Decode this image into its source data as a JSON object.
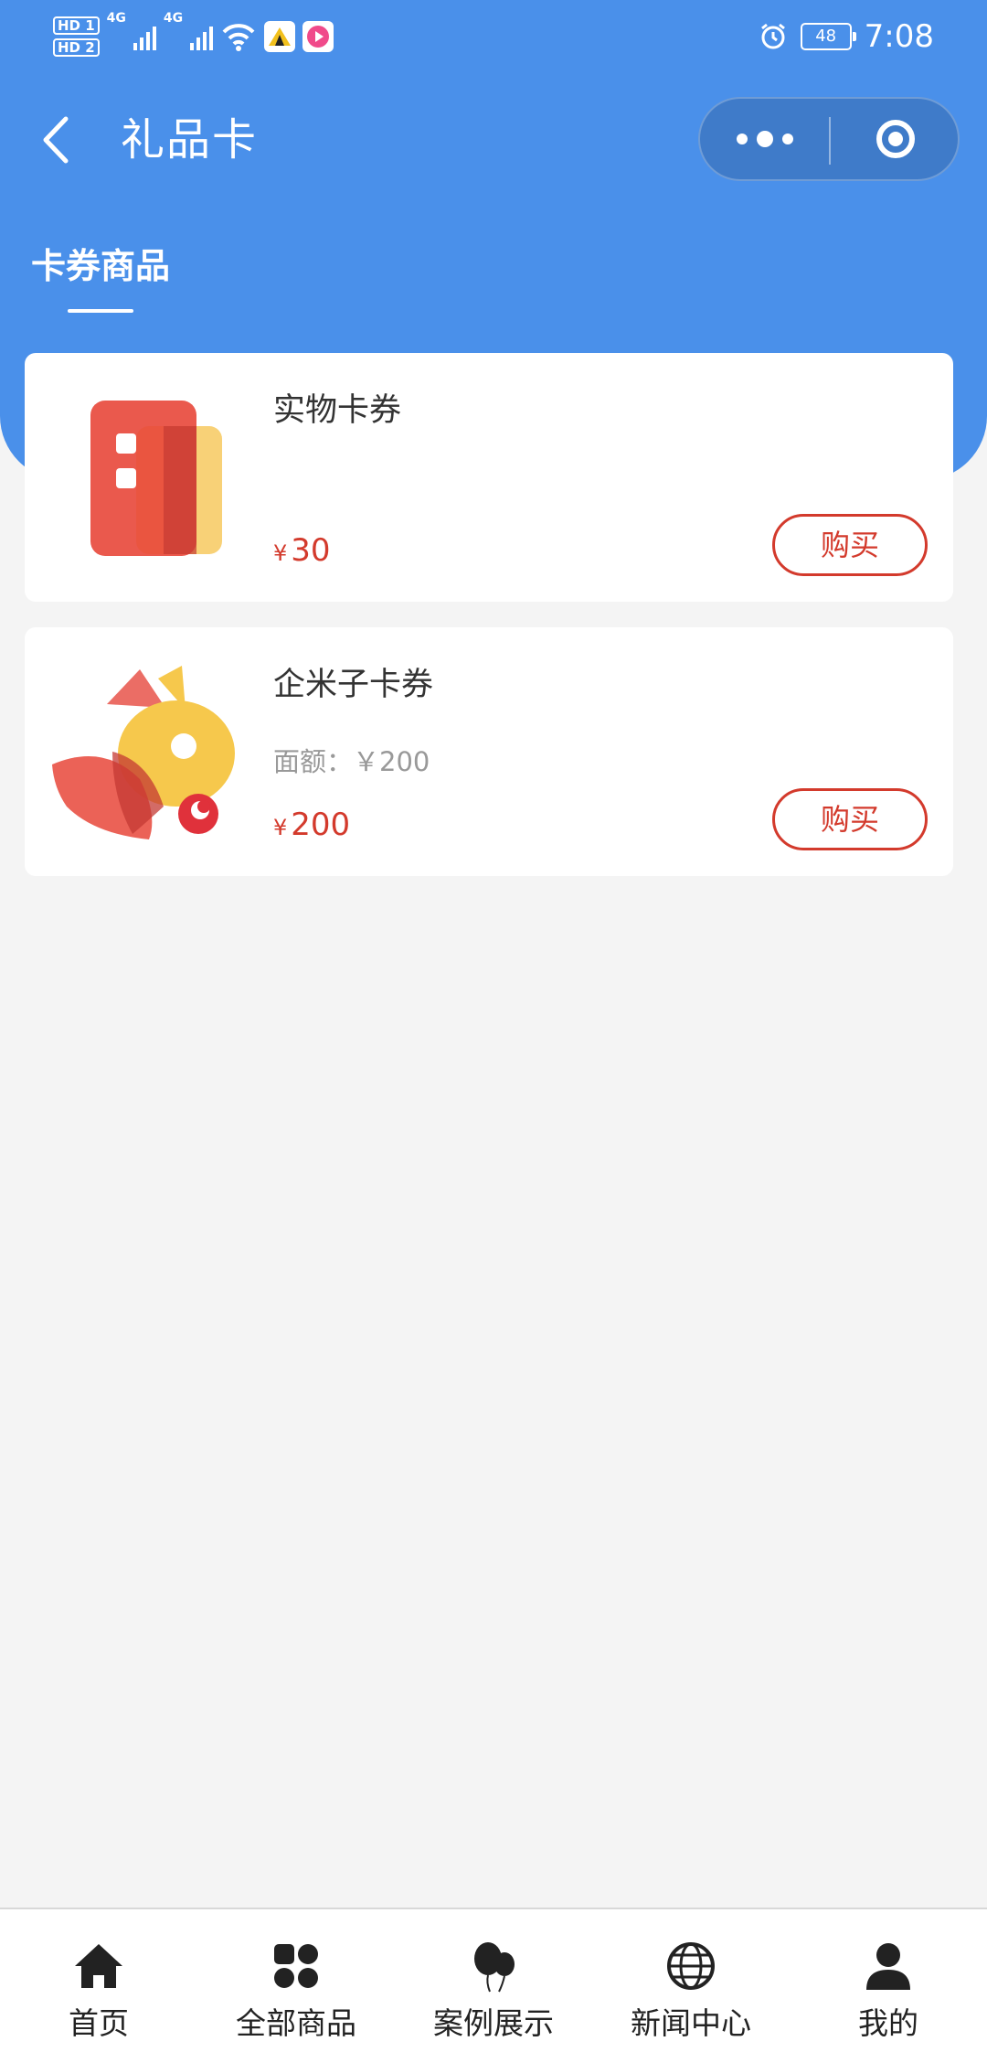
{
  "status_bar": {
    "hd1": "HD 1",
    "hd2": "HD 2",
    "net1": "4G",
    "net2": "4G",
    "battery": "48",
    "time": "7:08"
  },
  "navbar": {
    "title": "礼品卡"
  },
  "tab": {
    "label": "卡券商品"
  },
  "products": [
    {
      "title": "实物卡券",
      "subtitle": "",
      "price_symbol": "¥",
      "price": "30",
      "buy_label": "购买"
    },
    {
      "title": "企米子卡券",
      "subtitle": "面额：￥200",
      "price_symbol": "¥",
      "price": "200",
      "buy_label": "购买"
    }
  ],
  "tabbar": {
    "items": [
      {
        "label": "首页",
        "icon": "home-icon"
      },
      {
        "label": "全部商品",
        "icon": "grid-icon"
      },
      {
        "label": "案例展示",
        "icon": "balloons-icon"
      },
      {
        "label": "新闻中心",
        "icon": "globe-icon"
      },
      {
        "label": "我的",
        "icon": "user-icon"
      }
    ]
  },
  "colors": {
    "header": "#4a90ea",
    "price": "#d33a2c",
    "background": "#f4f4f4"
  }
}
